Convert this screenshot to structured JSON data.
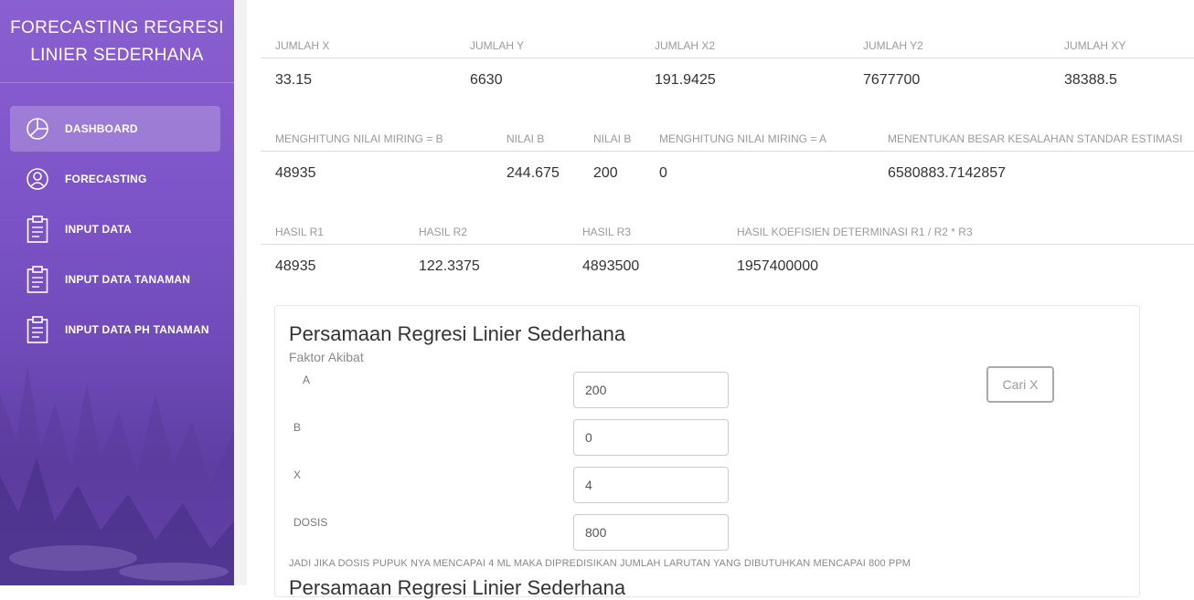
{
  "sidebar": {
    "brand": [
      "FORECASTING REGRESI",
      "LINIER SEDERHANA"
    ],
    "items": [
      {
        "label": "DASHBOARD",
        "icon": "pie-chart-icon",
        "active": true
      },
      {
        "label": "FORECASTING",
        "icon": "user-icon",
        "active": false
      },
      {
        "label": "INPUT DATA",
        "icon": "clipboard-icon",
        "active": false
      },
      {
        "label": "INPUT DATA TANAMAN",
        "icon": "clipboard-icon",
        "active": false
      },
      {
        "label": "INPUT DATA PH TANAMAN",
        "icon": "clipboard-icon",
        "active": false
      }
    ],
    "colors": {
      "top": "#8a5fd0",
      "bottom": "#5d3fa3"
    }
  },
  "table1": {
    "headers": [
      "JUMLAH X",
      "JUMLAH Y",
      "JUMLAH X2",
      "JUMLAH Y2",
      "JUMLAH XY"
    ],
    "values": [
      "33.15",
      "6630",
      "191.9425",
      "7677700",
      "38388.5"
    ]
  },
  "table2": {
    "headers": [
      "MENGHITUNG NILAI MIRING = B",
      "NILAI B",
      "NILAI B",
      "MENGHITUNG NILAI MIRING = A",
      "MENENTUKAN BESAR KESALAHAN STANDAR ESTIMASI"
    ],
    "values": [
      "48935",
      "244.675",
      "200",
      "0",
      "6580883.7142857"
    ]
  },
  "table3": {
    "headers": [
      "HASIL R1",
      "HASIL R2",
      "HASIL R3",
      "HASIL KOEFISIEN DETERMINASI R1 / R2 * R3"
    ],
    "values": [
      "48935",
      "122.3375",
      "4893500",
      "1957400000"
    ]
  },
  "card": {
    "title": "Persamaan Regresi Linier Sederhana",
    "subtitle": "Faktor Akibat",
    "fields": [
      {
        "label": "A",
        "value": "200"
      },
      {
        "label": "B",
        "value": "0"
      },
      {
        "label": "X",
        "value": "4"
      },
      {
        "label": "DOSIS",
        "value": "800"
      }
    ],
    "button": "Cari X",
    "note": "JADI JIKA DOSIS PUPUK NYA MENCAPAI 4 ML MAKA DIPREDISIKAN JUMLAH LARUTAN YANG DIBUTUHKAN MENCAPAI 800 PPM",
    "next_title": "Persamaan Regresi Linier Sederhana"
  }
}
